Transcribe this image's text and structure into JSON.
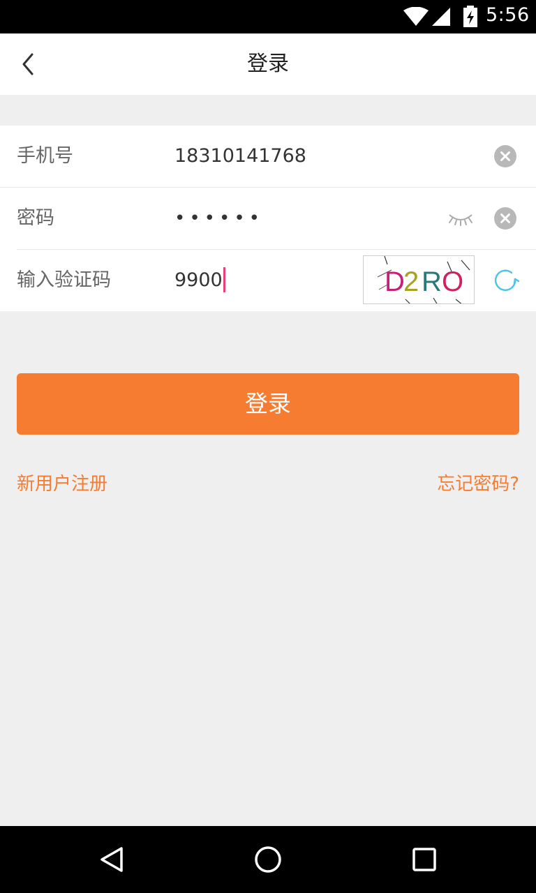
{
  "status_bar": {
    "time": "5:56",
    "icons": [
      "wifi-icon",
      "cell-signal-icon",
      "battery-charging-icon"
    ]
  },
  "header": {
    "title": "登录",
    "back_icon": "chevron-left-icon"
  },
  "form": {
    "phone": {
      "label": "手机号",
      "value": "18310141768"
    },
    "password": {
      "label": "密码",
      "value": "••••••"
    },
    "captcha": {
      "label": "输入验证码",
      "value": "9900",
      "image_text": "D2RO"
    }
  },
  "actions": {
    "login_label": "登录",
    "register_label": "新用户注册",
    "forgot_label": "忘记密码?"
  },
  "colors": {
    "accent": "#f57c31",
    "refresh": "#4fc3e8",
    "caret": "#e8407a",
    "background": "#efefef"
  },
  "nav_bar": {
    "icons": [
      "nav-back-icon",
      "nav-home-icon",
      "nav-recent-icon"
    ]
  }
}
